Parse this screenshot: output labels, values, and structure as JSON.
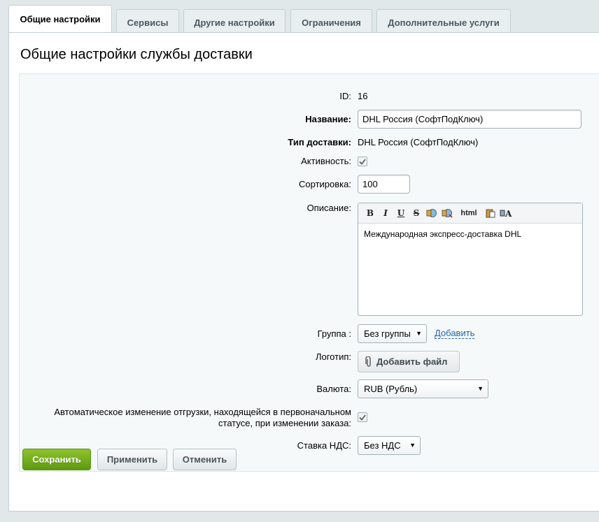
{
  "tabs": [
    {
      "label": "Общие настройки"
    },
    {
      "label": "Сервисы"
    },
    {
      "label": "Другие настройки"
    },
    {
      "label": "Ограничения"
    },
    {
      "label": "Дополнительные услуги"
    }
  ],
  "title": "Общие настройки службы доставки",
  "form": {
    "id_label": "ID:",
    "id_value": "16",
    "name_label": "Название:",
    "name_value": "DHL Россия (СофтПодКлюч)",
    "type_label": "Тип доставки:",
    "type_value": "DHL Россия (СофтПодКлюч)",
    "active_label": "Активность:",
    "sort_label": "Сортировка:",
    "sort_value": "100",
    "desc_label": "Описание:",
    "desc_value": "Международная экспресс-доставка DHL",
    "toolbar": {
      "bold": "B",
      "italic": "I",
      "underline": "U",
      "strike": "S",
      "html": "html"
    },
    "group_label": "Группа :",
    "group_value": "Без группы",
    "group_add": "Добавить",
    "logo_label": "Логотип:",
    "logo_button": "Добавить файл",
    "currency_label": "Валюта:",
    "currency_value": "RUB (Рубль)",
    "auto_label_line1": "Автоматическое изменение отгрузки, находящейся в первоначальном",
    "auto_label_line2": "статусе, при изменении заказа:",
    "vat_label": "Ставка НДС:",
    "vat_value": "Без НДС"
  },
  "buttons": {
    "save": "Сохранить",
    "apply": "Применить",
    "cancel": "Отменить"
  },
  "colors": {
    "accent_green": "#76b01f",
    "link_blue": "#2067b0"
  }
}
